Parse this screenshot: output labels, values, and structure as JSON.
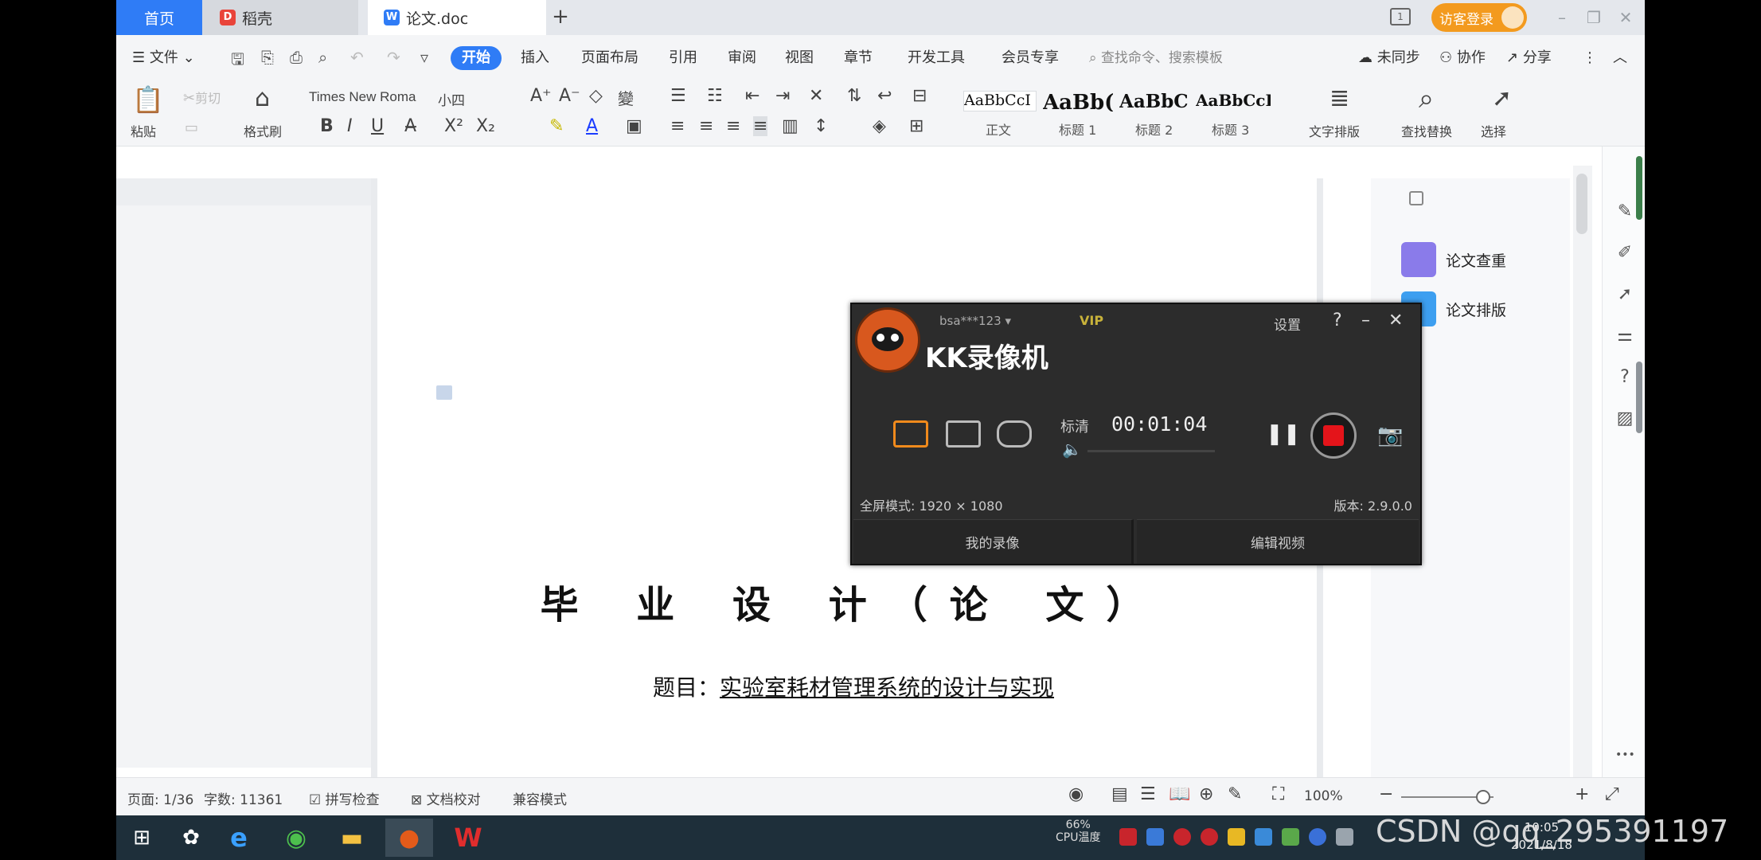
{
  "titlebar": {
    "tabs": [
      {
        "label": "首页"
      },
      {
        "label": "稻壳"
      },
      {
        "label": "论文.doc"
      }
    ],
    "add_tab": "+",
    "login": "访客登录"
  },
  "menubar": {
    "file": "文件",
    "items": [
      "开始",
      "插入",
      "页面布局",
      "引用",
      "审阅",
      "视图",
      "章节",
      "开发工具",
      "会员专享"
    ],
    "search_placeholder": "查找命令、搜索模板",
    "unsync": "未同步",
    "collab": "协作",
    "share": "分享"
  },
  "ribbon": {
    "paste": "粘贴",
    "cut": "剪切",
    "format_painter": "格式刷",
    "font_name": "Times New Roma",
    "font_size": "小四",
    "styles": [
      {
        "preview": "AaBbCcI",
        "label": "正文"
      },
      {
        "preview": "AaBb(",
        "label": "标题 1"
      },
      {
        "preview": "AaBbC",
        "label": "标题 2"
      },
      {
        "preview": "AaBbCcI",
        "label": "标题 3"
      }
    ],
    "text_layout": "文字排版",
    "find_replace": "查找替换",
    "select": "选择"
  },
  "document": {
    "title": "毕 业 设 计（论 文）",
    "subject_label": "题目：",
    "subject_value": "实验室耗材管理系统的设计与实现"
  },
  "side_panel": {
    "items": [
      {
        "label": "论文查重",
        "color": "#8a7bea"
      },
      {
        "label": "论文排版",
        "color": "#3d9ff0"
      }
    ]
  },
  "statusbar": {
    "page": "页面: 1/36",
    "words": "字数: 11361",
    "spellcheck": "拼写检查",
    "proofread": "文档校对",
    "compat": "兼容模式",
    "zoom": "100%"
  },
  "kk_recorder": {
    "user": "bsa***123",
    "vip": "VIP",
    "settings": "设置",
    "title": "KK录像机",
    "quality": "标清",
    "time": "00:01:04",
    "fullscreen_mode": "全屏模式: 1920 × 1080",
    "version": "版本: 2.9.0.0",
    "my_recordings": "我的录像",
    "edit_video": "编辑视频"
  },
  "taskbar": {
    "cpu_percent": "66%",
    "cpu_label": "CPU温度",
    "time": "10:05",
    "date": "2021/8/18"
  },
  "watermark": "CSDN @qq_295391197",
  "colors": {
    "accent": "#2f7cf6",
    "login": "#f39a1e",
    "record": "#e4141a",
    "kk_bg": "#2c2c2c"
  }
}
